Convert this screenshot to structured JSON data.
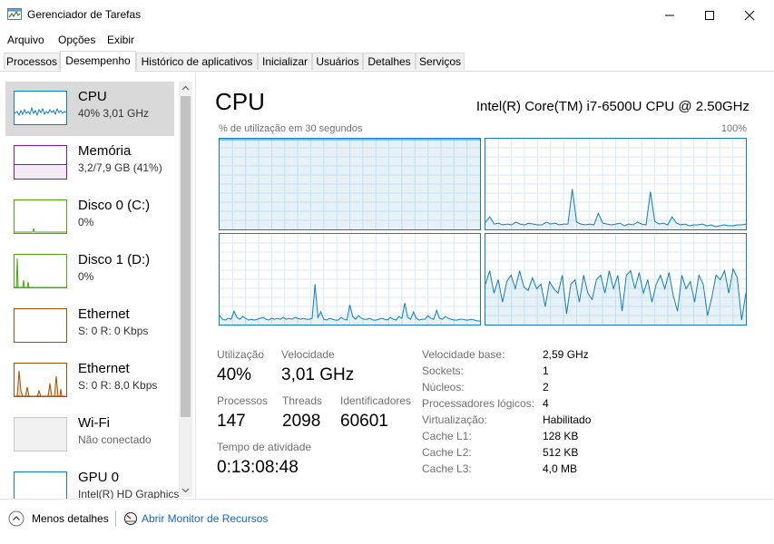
{
  "window": {
    "title": "Gerenciador de Tarefas"
  },
  "menu": [
    "Arquivo",
    "Opções",
    "Exibir"
  ],
  "tabs": [
    "Processos",
    "Desempenho",
    "Histórico de aplicativos",
    "Inicializar",
    "Usuários",
    "Detalhes",
    "Serviços"
  ],
  "sidebar": [
    {
      "name": "CPU",
      "sub": "40% 3,01 GHz",
      "color": "#117dbb",
      "selected": true
    },
    {
      "name": "Memória",
      "sub": "3,2/7,9 GB (41%)",
      "color": "#8b12ae"
    },
    {
      "name": "Disco 0 (C:)",
      "sub": "0%",
      "color": "#4da60c"
    },
    {
      "name": "Disco 1 (D:)",
      "sub": "0%",
      "color": "#4da60c"
    },
    {
      "name": "Ethernet",
      "sub": "S: 0 R: 0 Kbps",
      "color": "#a74f01"
    },
    {
      "name": "Ethernet",
      "sub": "S: 0 R: 8,0 Kbps",
      "color": "#a74f01"
    },
    {
      "name": "Wi-Fi",
      "sub": "Não conectado",
      "color": "#c8c8c8"
    },
    {
      "name": "GPU 0",
      "sub": "Intel(R) HD Graphics",
      "color": "#117dbb"
    }
  ],
  "main": {
    "title": "CPU",
    "cpu_model": "Intel(R) Core(TM) i7-6500U CPU @ 2.50GHz",
    "util_label": "% de utilização em 30 segundos",
    "max_label": "100%"
  },
  "stats": {
    "utilizacao_label": "Utilização",
    "utilizacao": "40%",
    "velocidade_label": "Velocidade",
    "velocidade": "3,01 GHz",
    "processos_label": "Processos",
    "processos": "147",
    "threads_label": "Threads",
    "threads": "2098",
    "identificadores_label": "Identificadores",
    "identificadores": "60601",
    "tempo_label": "Tempo de atividade",
    "tempo": "0:13:08:48"
  },
  "specs": [
    {
      "label": "Velocidade base:",
      "value": "2,59 GHz"
    },
    {
      "label": "Sockets:",
      "value": "1"
    },
    {
      "label": "Núcleos:",
      "value": "2"
    },
    {
      "label": "Processadores lógicos:",
      "value": "4"
    },
    {
      "label": "Virtualização:",
      "value": "Habilitado"
    },
    {
      "label": "Cache L1:",
      "value": "128 KB"
    },
    {
      "label": "Cache L2:",
      "value": "512 KB"
    },
    {
      "label": "Cache L3:",
      "value": "4,0 MB"
    }
  ],
  "footer": {
    "less_details": "Menos detalhes",
    "resource_monitor": "Abrir Monitor de Recursos"
  },
  "graphs": [
    {
      "values": [
        100,
        100,
        100,
        100,
        100,
        100,
        100,
        100,
        100,
        100,
        100,
        100,
        100,
        100,
        100,
        100,
        100,
        100,
        100,
        100,
        100,
        100,
        100,
        100,
        100,
        100,
        100,
        100,
        100,
        100,
        100
      ]
    },
    {
      "values": [
        8,
        14,
        6,
        7,
        5,
        6,
        5,
        8,
        6,
        5,
        7,
        6,
        5,
        5,
        8,
        6,
        7,
        5,
        6,
        6,
        45,
        8,
        6,
        5,
        6,
        5,
        18,
        7,
        6,
        5,
        6,
        7,
        4,
        6,
        5,
        8,
        6,
        5,
        42,
        9,
        6,
        7,
        5,
        14,
        7,
        5,
        6,
        4,
        5,
        5,
        6,
        4,
        5,
        3,
        4,
        5,
        4,
        4,
        5,
        5,
        6
      ]
    },
    {
      "values": [
        10,
        6,
        5,
        7,
        6,
        15,
        8,
        6,
        9,
        7,
        5,
        6,
        5,
        6,
        7,
        8,
        6,
        5,
        7,
        6,
        7,
        6,
        8,
        6,
        7,
        6,
        8,
        7,
        6,
        7,
        6,
        6,
        7,
        45,
        8,
        14,
        6,
        5,
        7,
        6,
        5,
        5,
        8,
        6,
        5,
        22,
        9,
        6,
        10,
        7,
        6,
        6,
        7,
        5,
        5,
        6,
        7,
        6,
        5,
        8,
        6,
        5,
        9,
        7,
        24,
        8,
        6,
        14,
        7,
        5,
        6,
        6,
        10,
        7,
        6,
        16,
        7,
        6,
        9,
        7,
        6,
        5,
        5,
        6,
        6,
        5,
        5,
        6,
        5,
        4,
        4
      ]
    },
    {
      "values": [
        45,
        60,
        35,
        50,
        25,
        48,
        55,
        40,
        60,
        42,
        38,
        52,
        40,
        45,
        20,
        48,
        40,
        35,
        55,
        12,
        45,
        50,
        25,
        55,
        35,
        28,
        50,
        55,
        35,
        60,
        40,
        55,
        15,
        55,
        60,
        40,
        58,
        35,
        50,
        25,
        45,
        55,
        40,
        58,
        32,
        15,
        55,
        40,
        48,
        25,
        55,
        45,
        10,
        30,
        55,
        50,
        60,
        35,
        62,
        52,
        5,
        35
      ]
    }
  ]
}
